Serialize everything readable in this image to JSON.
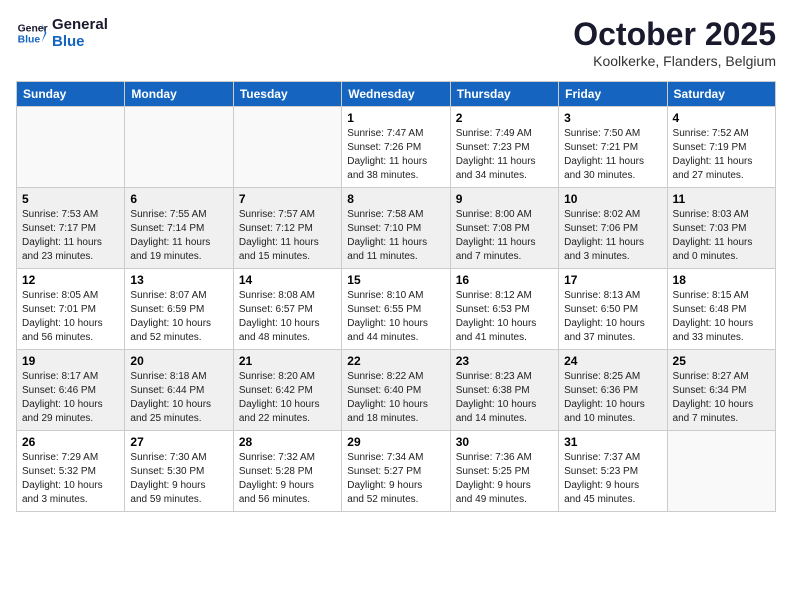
{
  "header": {
    "logo_line1": "General",
    "logo_line2": "Blue",
    "month": "October 2025",
    "location": "Koolkerke, Flanders, Belgium"
  },
  "weekdays": [
    "Sunday",
    "Monday",
    "Tuesday",
    "Wednesday",
    "Thursday",
    "Friday",
    "Saturday"
  ],
  "weeks": [
    [
      {
        "day": "",
        "info": ""
      },
      {
        "day": "",
        "info": ""
      },
      {
        "day": "",
        "info": ""
      },
      {
        "day": "1",
        "info": "Sunrise: 7:47 AM\nSunset: 7:26 PM\nDaylight: 11 hours\nand 38 minutes."
      },
      {
        "day": "2",
        "info": "Sunrise: 7:49 AM\nSunset: 7:23 PM\nDaylight: 11 hours\nand 34 minutes."
      },
      {
        "day": "3",
        "info": "Sunrise: 7:50 AM\nSunset: 7:21 PM\nDaylight: 11 hours\nand 30 minutes."
      },
      {
        "day": "4",
        "info": "Sunrise: 7:52 AM\nSunset: 7:19 PM\nDaylight: 11 hours\nand 27 minutes."
      }
    ],
    [
      {
        "day": "5",
        "info": "Sunrise: 7:53 AM\nSunset: 7:17 PM\nDaylight: 11 hours\nand 23 minutes."
      },
      {
        "day": "6",
        "info": "Sunrise: 7:55 AM\nSunset: 7:14 PM\nDaylight: 11 hours\nand 19 minutes."
      },
      {
        "day": "7",
        "info": "Sunrise: 7:57 AM\nSunset: 7:12 PM\nDaylight: 11 hours\nand 15 minutes."
      },
      {
        "day": "8",
        "info": "Sunrise: 7:58 AM\nSunset: 7:10 PM\nDaylight: 11 hours\nand 11 minutes."
      },
      {
        "day": "9",
        "info": "Sunrise: 8:00 AM\nSunset: 7:08 PM\nDaylight: 11 hours\nand 7 minutes."
      },
      {
        "day": "10",
        "info": "Sunrise: 8:02 AM\nSunset: 7:06 PM\nDaylight: 11 hours\nand 3 minutes."
      },
      {
        "day": "11",
        "info": "Sunrise: 8:03 AM\nSunset: 7:03 PM\nDaylight: 11 hours\nand 0 minutes."
      }
    ],
    [
      {
        "day": "12",
        "info": "Sunrise: 8:05 AM\nSunset: 7:01 PM\nDaylight: 10 hours\nand 56 minutes."
      },
      {
        "day": "13",
        "info": "Sunrise: 8:07 AM\nSunset: 6:59 PM\nDaylight: 10 hours\nand 52 minutes."
      },
      {
        "day": "14",
        "info": "Sunrise: 8:08 AM\nSunset: 6:57 PM\nDaylight: 10 hours\nand 48 minutes."
      },
      {
        "day": "15",
        "info": "Sunrise: 8:10 AM\nSunset: 6:55 PM\nDaylight: 10 hours\nand 44 minutes."
      },
      {
        "day": "16",
        "info": "Sunrise: 8:12 AM\nSunset: 6:53 PM\nDaylight: 10 hours\nand 41 minutes."
      },
      {
        "day": "17",
        "info": "Sunrise: 8:13 AM\nSunset: 6:50 PM\nDaylight: 10 hours\nand 37 minutes."
      },
      {
        "day": "18",
        "info": "Sunrise: 8:15 AM\nSunset: 6:48 PM\nDaylight: 10 hours\nand 33 minutes."
      }
    ],
    [
      {
        "day": "19",
        "info": "Sunrise: 8:17 AM\nSunset: 6:46 PM\nDaylight: 10 hours\nand 29 minutes."
      },
      {
        "day": "20",
        "info": "Sunrise: 8:18 AM\nSunset: 6:44 PM\nDaylight: 10 hours\nand 25 minutes."
      },
      {
        "day": "21",
        "info": "Sunrise: 8:20 AM\nSunset: 6:42 PM\nDaylight: 10 hours\nand 22 minutes."
      },
      {
        "day": "22",
        "info": "Sunrise: 8:22 AM\nSunset: 6:40 PM\nDaylight: 10 hours\nand 18 minutes."
      },
      {
        "day": "23",
        "info": "Sunrise: 8:23 AM\nSunset: 6:38 PM\nDaylight: 10 hours\nand 14 minutes."
      },
      {
        "day": "24",
        "info": "Sunrise: 8:25 AM\nSunset: 6:36 PM\nDaylight: 10 hours\nand 10 minutes."
      },
      {
        "day": "25",
        "info": "Sunrise: 8:27 AM\nSunset: 6:34 PM\nDaylight: 10 hours\nand 7 minutes."
      }
    ],
    [
      {
        "day": "26",
        "info": "Sunrise: 7:29 AM\nSunset: 5:32 PM\nDaylight: 10 hours\nand 3 minutes."
      },
      {
        "day": "27",
        "info": "Sunrise: 7:30 AM\nSunset: 5:30 PM\nDaylight: 9 hours\nand 59 minutes."
      },
      {
        "day": "28",
        "info": "Sunrise: 7:32 AM\nSunset: 5:28 PM\nDaylight: 9 hours\nand 56 minutes."
      },
      {
        "day": "29",
        "info": "Sunrise: 7:34 AM\nSunset: 5:27 PM\nDaylight: 9 hours\nand 52 minutes."
      },
      {
        "day": "30",
        "info": "Sunrise: 7:36 AM\nSunset: 5:25 PM\nDaylight: 9 hours\nand 49 minutes."
      },
      {
        "day": "31",
        "info": "Sunrise: 7:37 AM\nSunset: 5:23 PM\nDaylight: 9 hours\nand 45 minutes."
      },
      {
        "day": "",
        "info": ""
      }
    ]
  ]
}
